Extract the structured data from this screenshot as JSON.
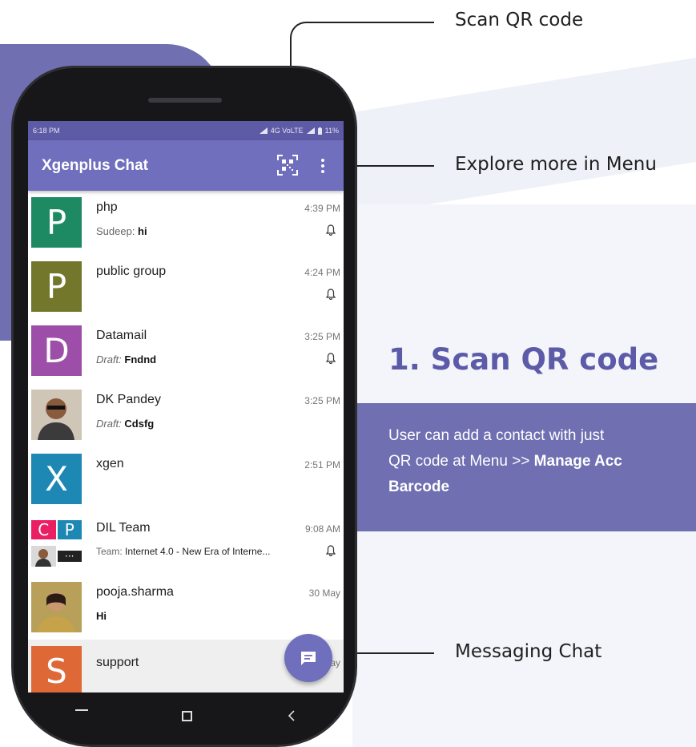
{
  "callouts": {
    "scan": "Scan QR code",
    "menu": "Explore more in Menu",
    "messaging": "Messaging Chat"
  },
  "feature": {
    "headline": "1. Scan QR code",
    "desc_line1": "User can add a contact with just",
    "desc_line2_pre": "QR code at Menu >> ",
    "desc_line2_bold": "Manage Acc",
    "desc_line3_bold": "Barcode"
  },
  "phone": {
    "status": {
      "time": "6:18 PM",
      "network": "4G VoLTE",
      "battery": "11%"
    },
    "app_title": "Xgenplus Chat",
    "chats": [
      {
        "avatar_letter": "P",
        "avatar_color": "#1d8a63",
        "name": "php",
        "time": "4:39 PM",
        "prefix": "Sudeep: ",
        "prefix_italic": false,
        "message": "hi",
        "muted": true
      },
      {
        "avatar_letter": "P",
        "avatar_color": "#72772b",
        "name": "public group",
        "time": "4:24 PM",
        "prefix": "",
        "prefix_italic": false,
        "message": "",
        "muted": true
      },
      {
        "avatar_letter": "D",
        "avatar_color": "#9c4ea8",
        "name": "Datamail",
        "time": "3:25 PM",
        "prefix": "Draft: ",
        "prefix_italic": true,
        "message": "Fndnd",
        "muted": true
      },
      {
        "avatar_letter": "",
        "avatar_color": "#7a6a58",
        "name": "DK Pandey",
        "time": "3:25 PM",
        "prefix": "Draft: ",
        "prefix_italic": true,
        "message": "Cdsfg",
        "muted": false
      },
      {
        "avatar_letter": "X",
        "avatar_color": "#1e88b5",
        "name": "xgen",
        "time": "2:51 PM",
        "prefix": "",
        "prefix_italic": false,
        "message": "",
        "muted": false
      },
      {
        "avatar_letter": "",
        "avatar_color": "#ffffff",
        "name": "DIL Team",
        "time": "9:08 AM",
        "prefix": "Team: ",
        "prefix_italic": false,
        "message": "Internet 4.0 - New Era of Interne...",
        "muted": true
      },
      {
        "avatar_letter": "",
        "avatar_color": "#b9a05a",
        "name": "pooja.sharma",
        "time": "30 May",
        "prefix": "",
        "prefix_italic": false,
        "message": "Hi",
        "muted": false
      },
      {
        "avatar_letter": "S",
        "avatar_color": "#df6936",
        "name": "support",
        "time": "ay",
        "prefix": "",
        "prefix_italic": false,
        "message": "",
        "muted": false
      }
    ],
    "dil_tiles": [
      "C",
      "P"
    ]
  },
  "colors": {
    "accent": "#6f6fb2",
    "app_bar": "#6f6fbd",
    "headline": "#5d5aa8"
  }
}
